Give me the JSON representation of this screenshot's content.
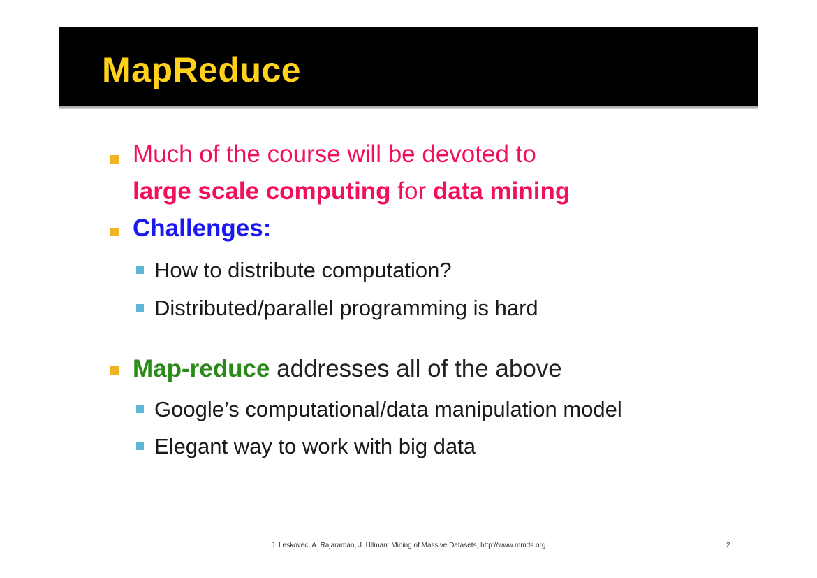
{
  "title": "MapReduce",
  "colors": {
    "title_text": "#ffd11a",
    "title_bar": "#000000",
    "level1_bullet": "#f0b323",
    "level2_bullet": "#5fb7d6",
    "pink": "#f2105e",
    "blue": "#1a1af0",
    "green": "#2a8a17"
  },
  "bullets": [
    {
      "line1": "Much of the course will be devoted to",
      "line2_a": "large scale computing",
      "line2_b": " for ",
      "line2_c": "data mining"
    },
    {
      "label": "Challenges:",
      "subitems": [
        "How to distribute computation?",
        "Distributed/parallel programming is hard"
      ]
    },
    {
      "label": "Map-reduce",
      "rest": " addresses all of the above",
      "subitems": [
        "Google’s computational/data manipulation model",
        "Elegant way to work with big data"
      ]
    }
  ],
  "footer": {
    "citation": "J. Leskovec, A. Rajaraman, J. Ullman: Mining of Massive Datasets, http://www.mmds.org",
    "page_number": "2"
  }
}
